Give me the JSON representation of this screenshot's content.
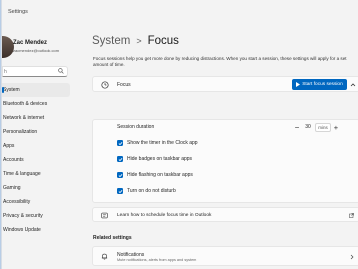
{
  "window": {
    "title": "Settings"
  },
  "profile": {
    "name": "Zac Mendez",
    "email": "zacmendez@outlook.com"
  },
  "search": {
    "value": "",
    "placeholder": "h"
  },
  "sidebar": {
    "items": [
      {
        "label": "System",
        "active": true
      },
      {
        "label": "Bluetooth & devices"
      },
      {
        "label": "Network & internet"
      },
      {
        "label": "Personalization"
      },
      {
        "label": "Apps"
      },
      {
        "label": "Accounts"
      },
      {
        "label": "Time & language"
      },
      {
        "label": "Gaming"
      },
      {
        "label": "Accessibility"
      },
      {
        "label": "Privacy & security"
      },
      {
        "label": "Windows Update"
      }
    ]
  },
  "breadcrumb": {
    "parent": "System",
    "separator": ">",
    "current": "Focus"
  },
  "description": "Focus sessions help you get more done by reducing distractions. When you start a session, these settings will apply for a set amount of time.",
  "focus": {
    "label": "Focus",
    "start_button": "Start focus session",
    "session_duration_label": "Session duration",
    "duration_value": "30",
    "duration_unit": "mins",
    "minus": "−",
    "plus": "+",
    "options": [
      {
        "label": "Show the timer in the Clock app",
        "checked": true
      },
      {
        "label": "Hide badges on taskbar apps",
        "checked": true
      },
      {
        "label": "Hide flashing on taskbar apps",
        "checked": true
      },
      {
        "label": "Turn on do not disturb",
        "checked": true
      }
    ]
  },
  "learn": {
    "label": "Learn how to schedule focus time in Outlook"
  },
  "related": {
    "heading": "Related settings",
    "notifications": {
      "label": "Notifications",
      "sub": "Mute notifications, alerts from apps and system"
    }
  },
  "colors": {
    "accent": "#0067c0",
    "background": "#f3f3f3",
    "card": "#fbfbfb"
  },
  "icons": {
    "search": "search-icon",
    "focus": "clock-icon",
    "collapse": "chevron-up-icon",
    "learn": "help-icon",
    "external": "external-link-icon",
    "notifications": "bell-icon",
    "arrow": "chevron-right-icon"
  }
}
